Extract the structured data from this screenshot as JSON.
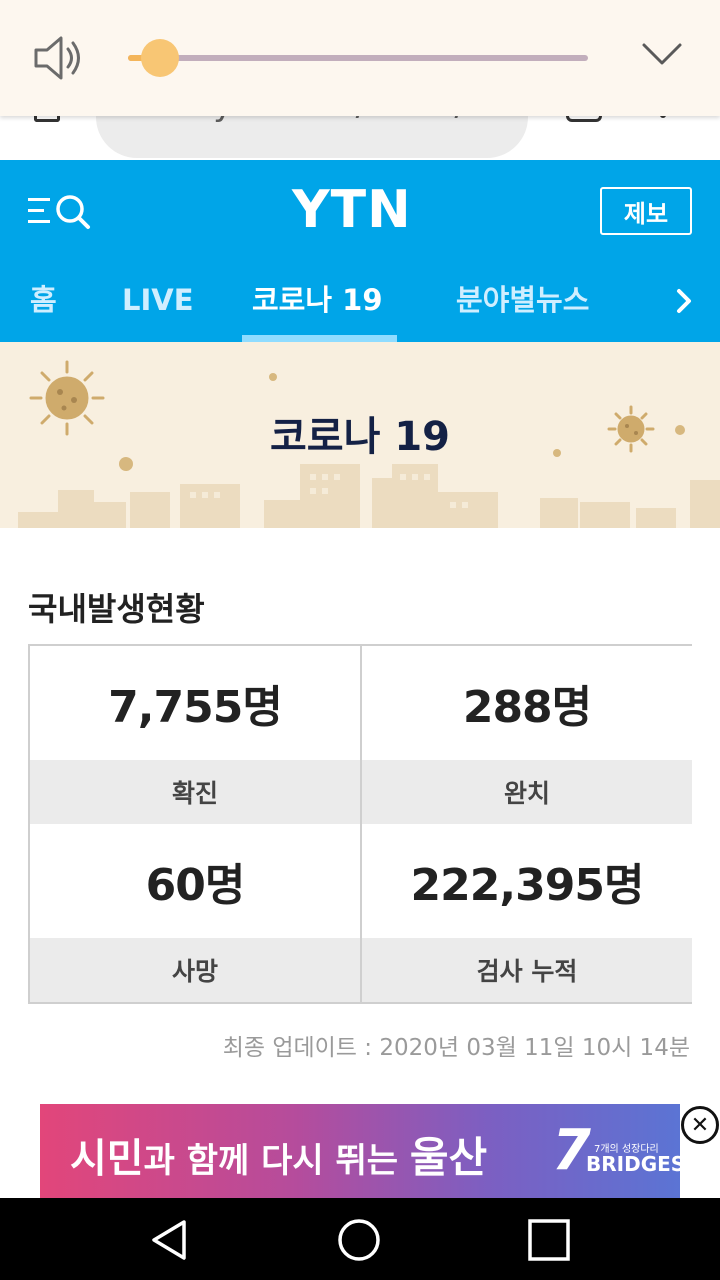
{
  "volume": {
    "level": 0.07,
    "colors": {
      "panel": "#fdf7ef",
      "track": "#c2aebc",
      "thumb": "#f8c674"
    }
  },
  "browser": {
    "url_fragment": "mythicolki/issue/"
  },
  "header": {
    "logo": "YTN",
    "report_button": "제보",
    "accent": "#00a5e8",
    "tabs": [
      {
        "label": "홈",
        "active": false
      },
      {
        "label": "LIVE",
        "active": false
      },
      {
        "label": "코로나 19",
        "active": true
      },
      {
        "label": "분야별뉴스",
        "active": false
      }
    ]
  },
  "banner": {
    "title": "코로나 19"
  },
  "stats": {
    "section_title": "국내발생현황",
    "cells": [
      {
        "value": "7,755명",
        "label": "확진"
      },
      {
        "value": "288명",
        "label": "완치"
      },
      {
        "value": "60명",
        "label": "사망"
      },
      {
        "value": "222,395명",
        "label": "검사 누적"
      }
    ],
    "update_label": "최종 업데이트 :",
    "update_time": "2020년 03월 11일 10시 14분"
  },
  "ad": {
    "text_part1": "시민",
    "text_part2": "과 함께 다시 뛰는 ",
    "text_part3": "울산",
    "brand_number": "7",
    "brand_small": "7개의 성장다리",
    "brand_name": "BRIDGES",
    "close_symbol": "✕"
  }
}
